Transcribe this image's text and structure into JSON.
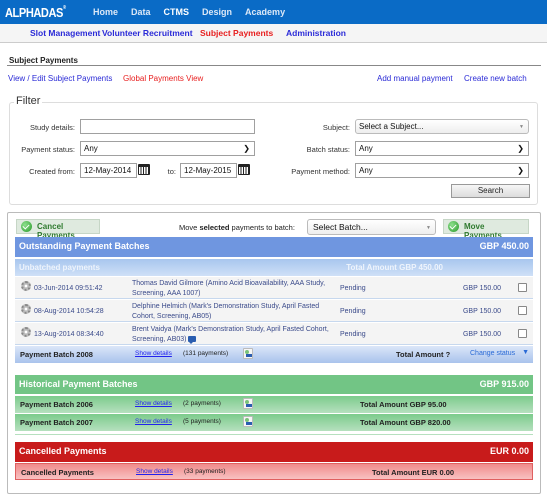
{
  "app": {
    "logo": "ALPHADAS",
    "logo_mark": "®"
  },
  "top_nav": [
    {
      "label": "Home",
      "active": false
    },
    {
      "label": "Data",
      "active": false
    },
    {
      "label": "CTMS",
      "active": true
    },
    {
      "label": "Design",
      "active": false
    },
    {
      "label": "Academy",
      "active": false
    }
  ],
  "sub_nav": [
    {
      "label": "Slot Management",
      "active": false
    },
    {
      "label": "Volunteer Recruitment",
      "active": false
    },
    {
      "label": "Subject Payments",
      "active": true
    },
    {
      "label": "Administration",
      "active": false
    }
  ],
  "page": {
    "title": "Subject Payments",
    "links": {
      "view_edit": "View / Edit Subject Payments",
      "global_view": "Global Payments View",
      "add_manual": "Add manual payment",
      "create_batch": "Create new batch"
    }
  },
  "filter": {
    "legend": "Filter",
    "study_details_label": "Study details:",
    "study_details_value": "",
    "payment_status_label": "Payment status:",
    "payment_status_value": "Any",
    "created_from_label": "Created from:",
    "created_from_value": "12-May-2014",
    "to_label": "to:",
    "created_to_value": "12-May-2015",
    "subject_label": "Subject:",
    "subject_value": "Select a Subject...",
    "batch_status_label": "Batch status:",
    "batch_status_value": "Any",
    "payment_method_label": "Payment method:",
    "payment_method_value": "Any",
    "search_label": "Search"
  },
  "actions": {
    "cancel_payments": "Cancel Payments",
    "move_label_pre": "Move ",
    "move_label_bold": "selected",
    "move_label_post": " payments to batch:",
    "batch_select_value": "Select Batch...",
    "move_payments": "Move Payments"
  },
  "outstanding": {
    "title": "Outstanding Payment Batches",
    "total": "GBP 450.00",
    "unbatched": {
      "title": "Unbatched payments",
      "total": "Total Amount GBP 450.00",
      "rows": [
        {
          "date": "03-Jun-2014 09:51:42",
          "desc": "Thomas David Gilmore (Amino Acid Bioavailability, AAA Study, Screening, AAA 1007)",
          "status": "Pending",
          "amount": "GBP 150.00",
          "checked": false,
          "has_comment": false
        },
        {
          "date": "08-Aug-2014 10:54:28",
          "desc": "Delphine Helmich (Mark's Demonstration Study, April Fasted Cohort, Screening, AB05)",
          "status": "Pending",
          "amount": "GBP 150.00",
          "checked": false,
          "has_comment": false
        },
        {
          "date": "13-Aug-2014 08:34:40",
          "desc": "Brent Vaidya (Mark's Demonstration Study, April Fasted Cohort, Screening, AB03)",
          "status": "Pending",
          "amount": "GBP 150.00",
          "checked": false,
          "has_comment": true
        }
      ]
    },
    "batch": {
      "name": "Payment Batch 2008",
      "show_details": "Show details",
      "count": "(131 payments)",
      "total": "Total Amount ?",
      "change_status": "Change status",
      "change_status_arrow": "▼"
    }
  },
  "historical": {
    "title": "Historical Payment Batches",
    "total": "GBP 915.00",
    "batches": [
      {
        "name": "Payment Batch 2006",
        "show_details": "Show details",
        "count": "(2 payments)",
        "total": "Total Amount GBP 95.00"
      },
      {
        "name": "Payment Batch 2007",
        "show_details": "Show details",
        "count": "(5 payments)",
        "total": "Total Amount GBP 820.00"
      }
    ]
  },
  "cancelled": {
    "title": "Cancelled Payments",
    "total": "EUR 0.00",
    "row": {
      "name": "Cancelled Payments",
      "show_details": "Show details",
      "count": "(33 payments)",
      "total": "Total Amount EUR 0.00"
    }
  },
  "colors": {
    "brand_blue": "#0a6bc6",
    "active_red": "#e82020",
    "outstanding_blue": "#6f96e0",
    "historical_green": "#72c585",
    "cancelled_red": "#c81b1b"
  }
}
